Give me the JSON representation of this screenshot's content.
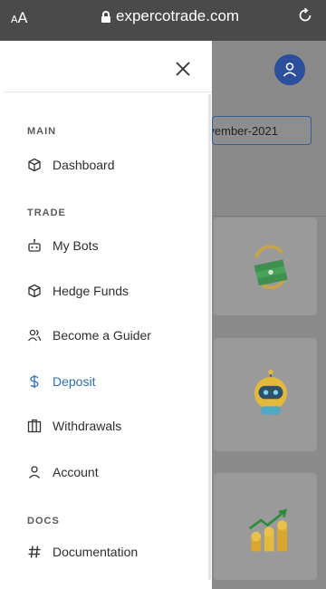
{
  "browser": {
    "aa_small": "A",
    "aa_large": "A",
    "url": "expercotrade.com"
  },
  "background": {
    "date_fragment": "vember-2021"
  },
  "drawer": {
    "sections": {
      "main": "MAIN",
      "trade": "TRADE",
      "docs": "DOCS"
    },
    "items": [
      {
        "label": "Dashboard",
        "icon": "cube-icon"
      },
      {
        "label": "My Bots",
        "icon": "robot-icon"
      },
      {
        "label": "Hedge Funds",
        "icon": "cube-icon"
      },
      {
        "label": "Become a Guider",
        "icon": "users-icon"
      },
      {
        "label": "Deposit",
        "icon": "dollar-icon",
        "active": true
      },
      {
        "label": "Withdrawals",
        "icon": "bank-icon"
      },
      {
        "label": "Account",
        "icon": "user-icon"
      },
      {
        "label": "Documentation",
        "icon": "hash-icon"
      }
    ]
  },
  "colors": {
    "accent": "#2f6fb4",
    "avatar": "#2c4f9c",
    "overlay": "#8a8a8a",
    "browser_bar": "#4a4a4a"
  }
}
